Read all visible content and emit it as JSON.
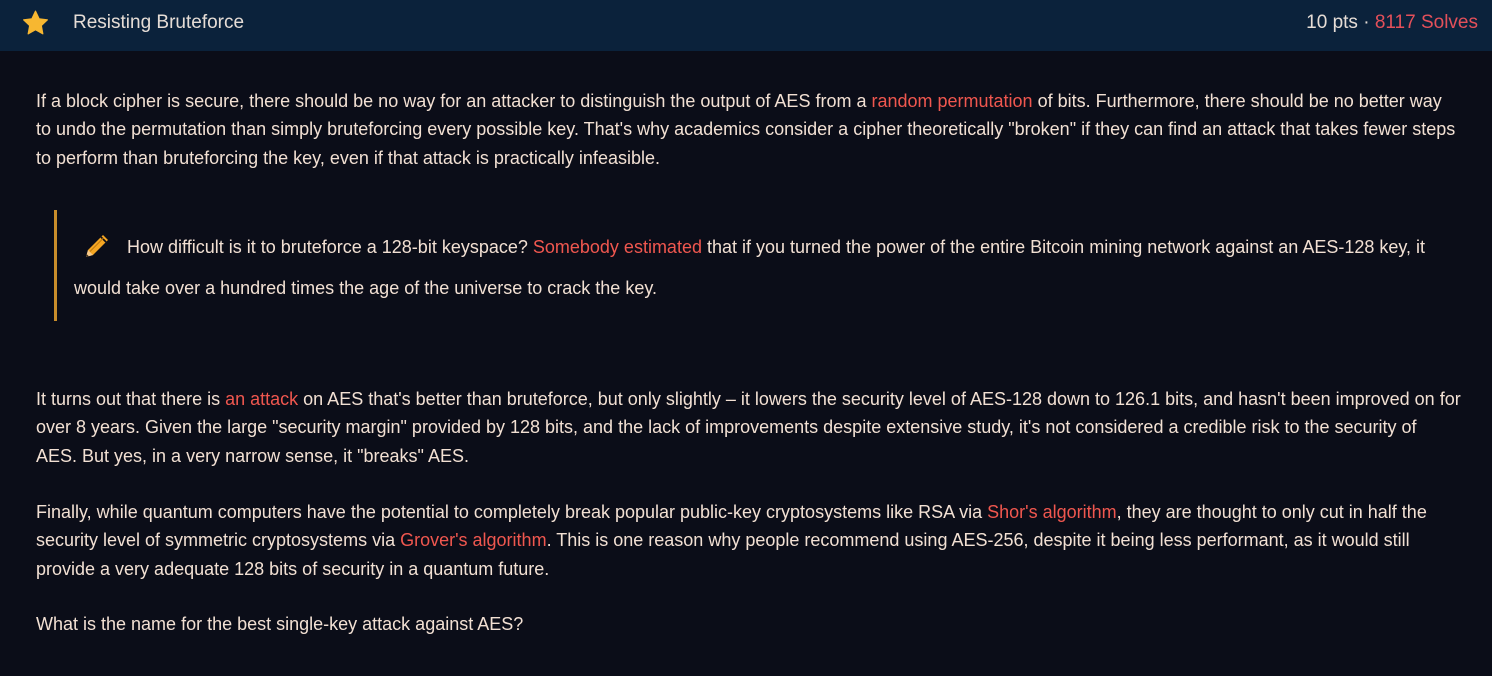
{
  "header": {
    "title": "Resisting Bruteforce",
    "points": "10 pts",
    "separator": " · ",
    "solves": "8117 Solves",
    "icon": "star-icon"
  },
  "colors": {
    "header_bg": "#0b223b",
    "page_bg": "#0b0d18",
    "link": "#f0574f",
    "star": "#f7b731",
    "note_border": "#c98d2b"
  },
  "body": {
    "p1": {
      "a": "If a block cipher is secure, there should be no way for an attacker to distinguish the output of AES from a ",
      "link": "random permutation",
      "b": " of bits. Furthermore, there should be no better way to undo the permutation than simply bruteforcing every possible key. That's why academics consider a cipher theoretically \"broken\" if they can find an attack that takes fewer steps to perform than bruteforcing the key, even if that attack is practically infeasible."
    },
    "note": {
      "icon": "pencil-icon",
      "a": "How difficult is it to bruteforce a 128-bit keyspace? ",
      "link": "Somebody estimated",
      "b": " that if you turned the power of the entire Bitcoin mining network against an AES-128 key, it would take over a hundred times the age of the universe to crack the key."
    },
    "p2": {
      "a": "It turns out that there is ",
      "link": "an attack",
      "b": " on AES that's better than bruteforce, but only slightly – it lowers the security level of AES-128 down to 126.1 bits, and hasn't been improved on for over 8 years. Given the large \"security margin\" provided by 128 bits, and the lack of improvements despite extensive study, it's not consid­ered a credible risk to the security of AES. But yes, in a very narrow sense, it \"breaks\" AES."
    },
    "p3": {
      "a": "Finally, while quantum computers have the potential to completely break popular public-key cryptosystems like RSA via ",
      "link1": "Shor's algorithm",
      "b": ", they are thought to only cut in half the security level of symmetric cryptosystems via ",
      "link2": "Grover's algorithm",
      "c": ". This is one reason why people recommend using AES-256, despite it being less performant, as it would still provide a very adequate 128 bits of security in a quantum future."
    },
    "question": "What is the name for the best single-key attack against AES?"
  }
}
